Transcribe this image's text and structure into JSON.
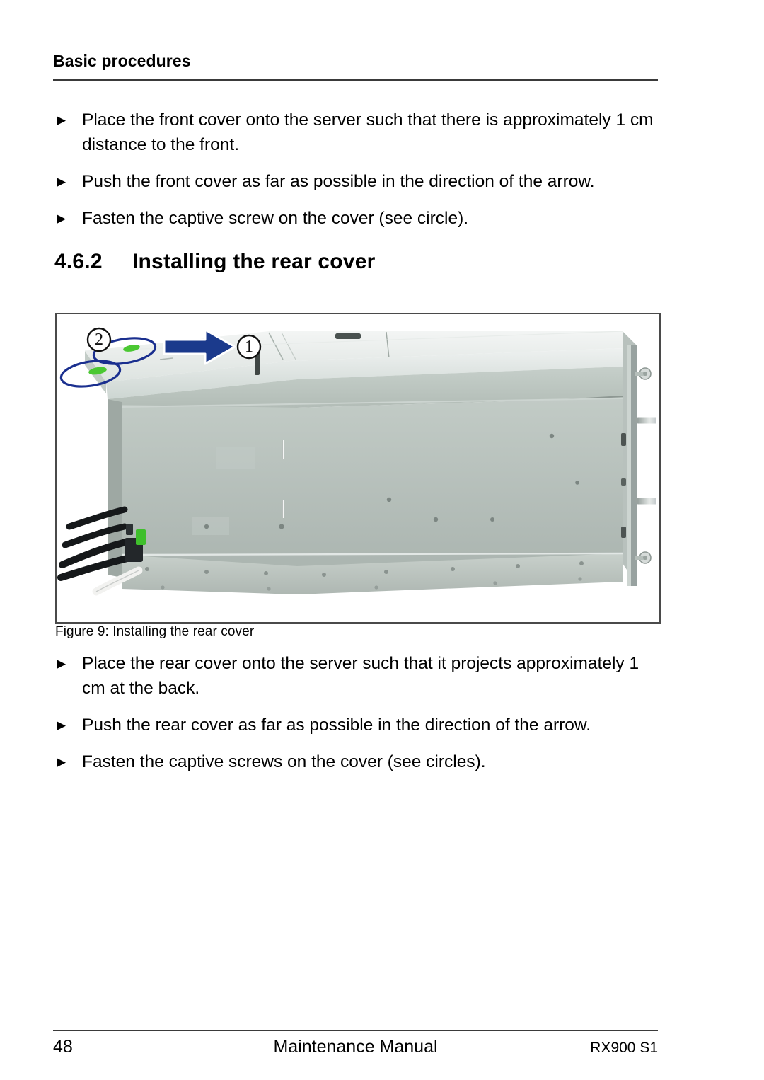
{
  "header": {
    "title": "Basic procedures"
  },
  "top_steps": [
    {
      "marker": "▶",
      "text": "Place the front cover onto the server such that there is approximately 1 cm distance to the front."
    },
    {
      "marker": "▶",
      "text": "Push the front cover as far as possible in the direction of the arrow."
    },
    {
      "marker": "▶",
      "text": "Fasten the captive screw on the cover (see circle)."
    }
  ],
  "section": {
    "number": "4.6.2",
    "title": "Installing the rear cover"
  },
  "figure": {
    "caption": "Figure 9: Installing the rear cover",
    "callouts": [
      {
        "id": "callout-1",
        "label": "①"
      },
      {
        "id": "callout-2",
        "label": "②"
      }
    ],
    "arrow_color": "#1b3a8c",
    "annotation_circle_color": "#1a2f8f",
    "captive_screw_color": "#4bc832",
    "chassis_color": "#b9c2bc",
    "cover_color": "#d7dedb"
  },
  "bottom_steps": [
    {
      "marker": "▶",
      "text": "Place the rear cover onto the server such that it projects approximately 1 cm at the back."
    },
    {
      "marker": "▶",
      "text": "Push the rear cover as far as possible in the direction of the arrow."
    },
    {
      "marker": "▶",
      "text": "Fasten the captive screws on the cover (see circles)."
    }
  ],
  "footer": {
    "page_number": "48",
    "center": "Maintenance Manual",
    "right": "RX900 S1"
  }
}
